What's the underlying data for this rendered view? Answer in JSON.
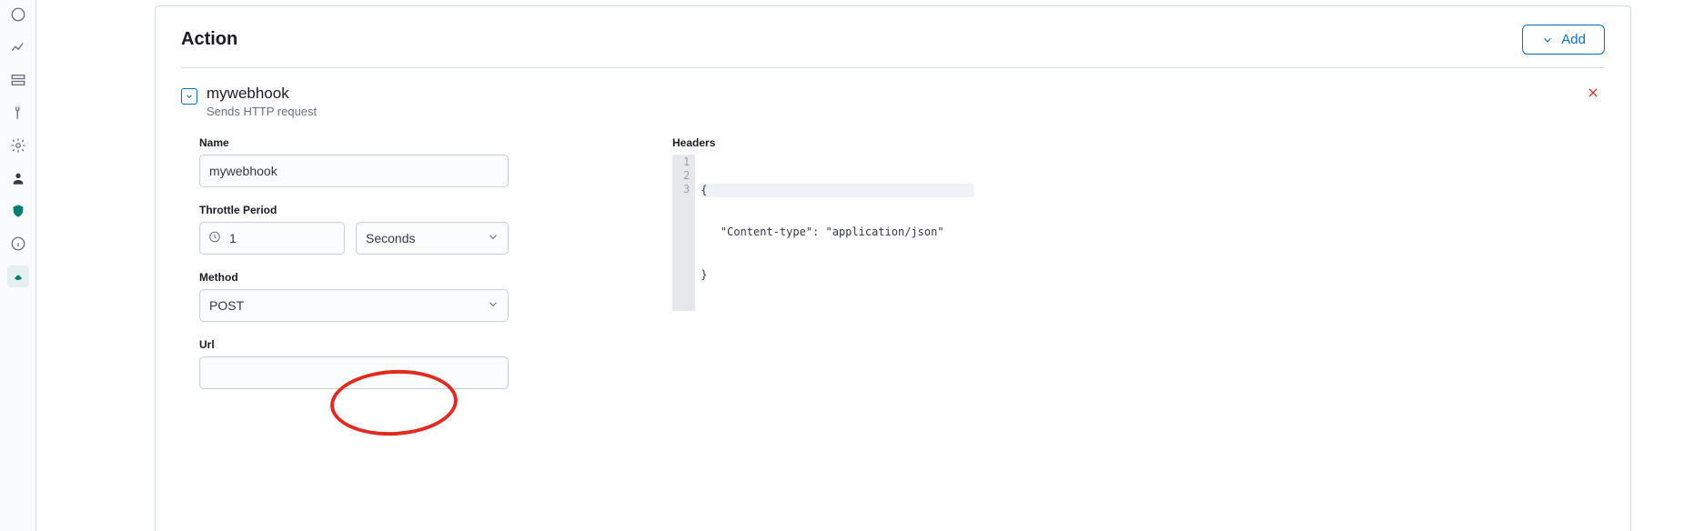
{
  "sidenav": {
    "items": [
      {
        "name": "dashboard-icon"
      },
      {
        "name": "visualize-icon"
      },
      {
        "name": "data-icon"
      },
      {
        "name": "devtools-icon"
      },
      {
        "name": "settings-icon"
      },
      {
        "name": "user-icon"
      },
      {
        "name": "security-icon"
      },
      {
        "name": "info-icon"
      },
      {
        "name": "app-icon"
      }
    ]
  },
  "panel": {
    "title": "Action",
    "add_label": "Add"
  },
  "action": {
    "title": "mywebhook",
    "subtitle": "Sends HTTP request"
  },
  "form": {
    "name_label": "Name",
    "name_value": "mywebhook",
    "throttle_label": "Throttle Period",
    "throttle_value": "1",
    "throttle_unit": "Seconds",
    "method_label": "Method",
    "method_value": "POST",
    "url_label": "Url",
    "url_value": "",
    "headers_label": "Headers",
    "headers_lines": [
      "{",
      "   \"Content-type\": \"application/json\"",
      "}"
    ]
  }
}
